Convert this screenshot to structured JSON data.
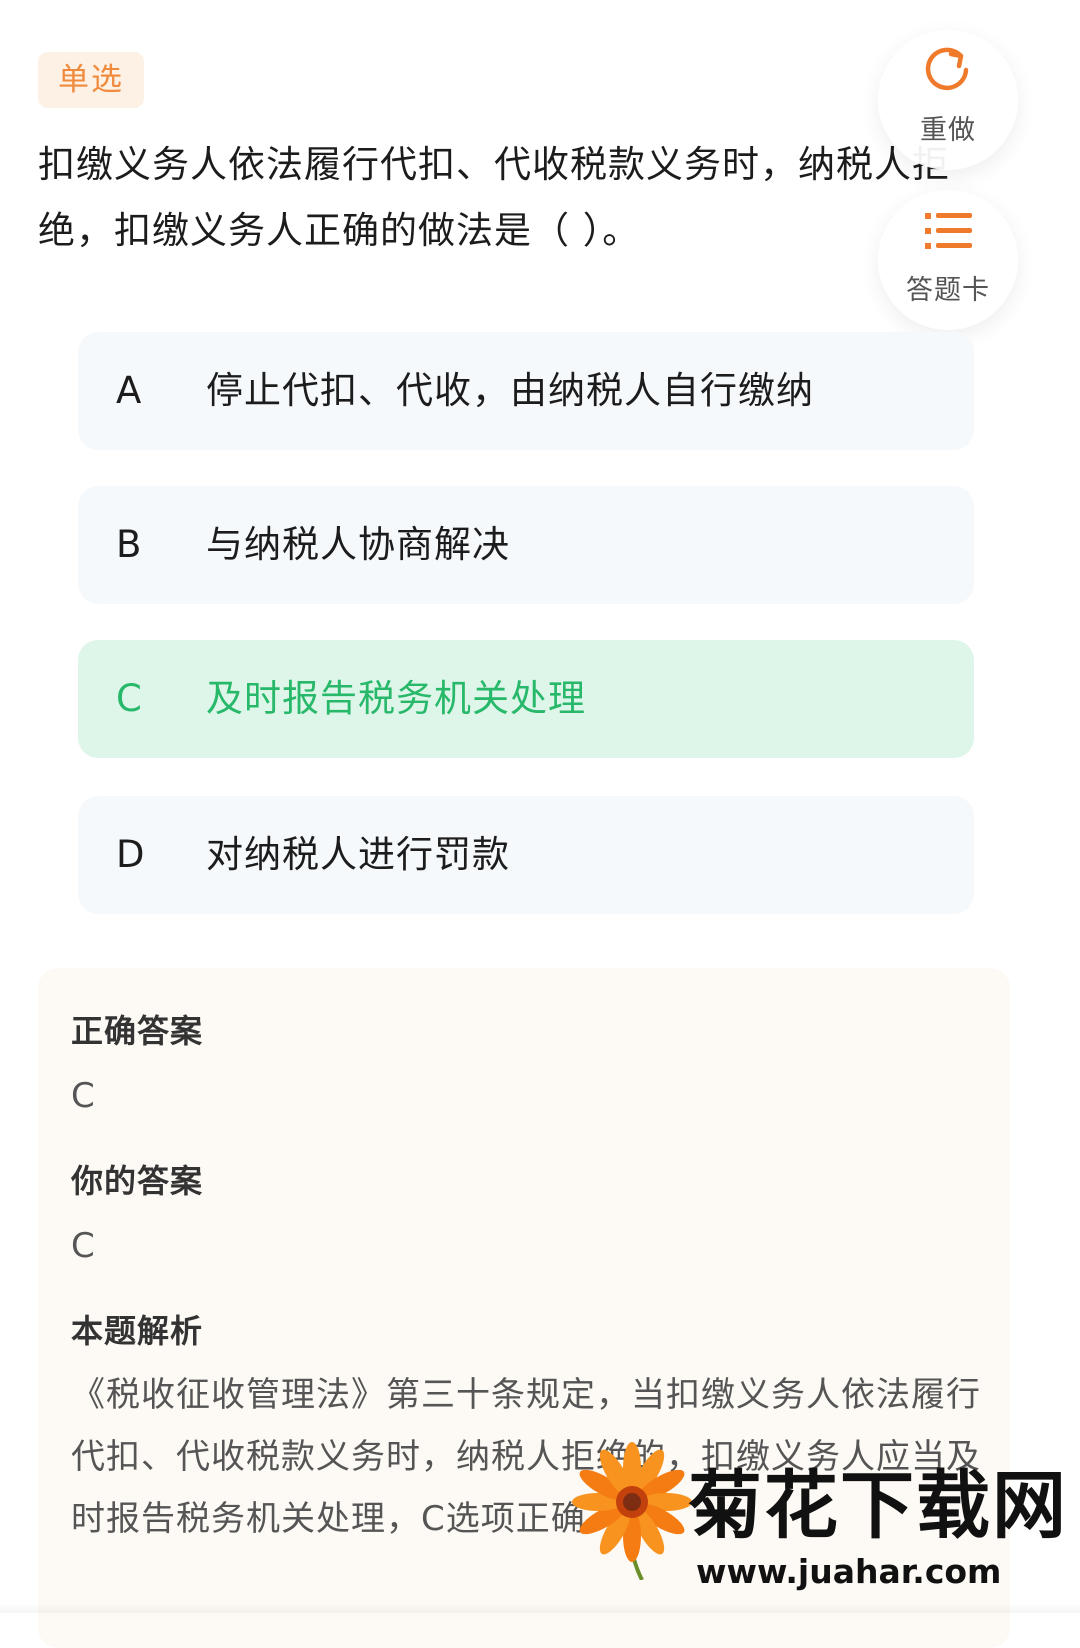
{
  "question": {
    "type_tag": "单选",
    "text": "扣缴义务人依法履行代扣、代收税款义务时，纳税人拒绝，扣缴义务人正确的做法是（ ）。"
  },
  "actions": {
    "redo_label": "重做",
    "answer_card_label": "答题卡"
  },
  "options": [
    {
      "letter": "A",
      "text": "停止代扣、代收，由纳税人自行缴纳",
      "state": "default"
    },
    {
      "letter": "B",
      "text": "与纳税人协商解决",
      "state": "default"
    },
    {
      "letter": "C",
      "text": "及时报告税务机关处理",
      "state": "correct"
    },
    {
      "letter": "D",
      "text": "对纳税人进行罚款",
      "state": "default"
    }
  ],
  "analysis": {
    "correct_answer_label": "正确答案",
    "correct_answer": "C",
    "your_answer_label": "你的答案",
    "your_answer": "C",
    "explanation_label": "本题解析",
    "explanation": "《税收征收管理法》第三十条规定，当扣缴义务人依法履行代扣、代收税款义务时，纳税人拒绝的，扣缴义务人应当及时报告税务机关处理，C选项正确。"
  },
  "watermark": {
    "title": "菊花下载网",
    "url": "www.juahar.com"
  },
  "colors": {
    "accent_orange": "#f08a3c",
    "correct_green": "#27b86a",
    "correct_bg": "#def6e9",
    "option_bg": "#f6f9fc",
    "analysis_bg": "#fdf9f5"
  }
}
